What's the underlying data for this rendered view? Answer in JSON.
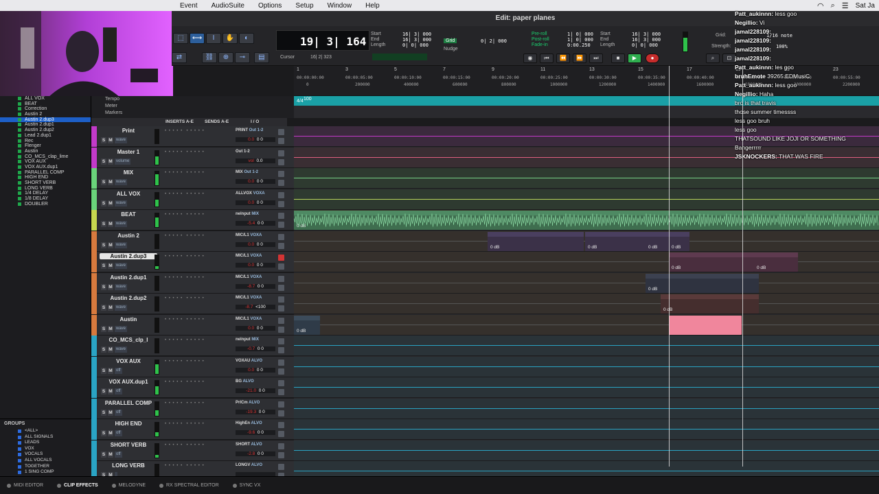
{
  "menubar": {
    "items": [
      "Event",
      "AudioSuite",
      "Options",
      "Setup",
      "Window",
      "Help"
    ],
    "clock": "Sat Ja"
  },
  "window": {
    "title": "Edit: paper planes"
  },
  "transport": {
    "main_counter": "19| 3| 164",
    "cursor_label": "Cursor",
    "cursor_value": "16| 2| 323",
    "start_label": "Start",
    "end_label": "End",
    "length_label": "Length",
    "start_value": "16| 3| 000",
    "end_value": "16| 3| 000",
    "length_value": "0| 0| 000",
    "grid_label": "Grid",
    "grid_value": "0| 2| 000",
    "nudge_label": "Nudge",
    "preroll_label": "Pre-roll",
    "postroll_label": "Post-roll",
    "fadein_label": "Fade-in",
    "preroll_value": "1| 0| 000",
    "postroll_value": "1| 0| 000",
    "fadein_value": "0:00.250",
    "start2_value": "16| 3| 000",
    "end2_value": "16| 3| 000",
    "length2_value": "0| 0| 000",
    "grid_right_label": "Grid:",
    "strength_label": "Strength:",
    "note_value": "1/16 note",
    "strength_value": "100%"
  },
  "ruler": {
    "bars": [
      "1",
      "3",
      "5",
      "7",
      "9",
      "11",
      "13",
      "15",
      "17",
      "19",
      "21",
      "23"
    ],
    "timecodes": [
      "00:00:00:00",
      "00:00:05:00",
      "00:00:10:00",
      "00:00:15:00",
      "00:00:20:00",
      "00:00:25:00",
      "00:00:30:00",
      "00:00:35:00",
      "00:00:40:00",
      "00:00:45:00",
      "00:00:50:00",
      "00:00:55:00"
    ],
    "samples": [
      "0",
      "200000",
      "400000",
      "600000",
      "800000",
      "1000000",
      "1200000",
      "1400000",
      "1600000",
      "1800000",
      "2000000",
      "2200000"
    ],
    "tempo_label": "Tempo",
    "meter_label": "Meter",
    "markers_label": "Markers",
    "tempo_value": "100",
    "meter_value": "4/4"
  },
  "clip_list": [
    "ALL VOX",
    "BEAT",
    "Correction",
    "Austin 2",
    "Austin 2.dup3",
    "Austin 2.dup1",
    "Austin 2.dup2",
    "Lead 2.dup1",
    "Rec",
    "Flenger",
    "Austin",
    "CO_MCS_clap_lime",
    "VOX AUX",
    "VOX AUX.dup1",
    "PARALLEL COMP",
    "HIGH END",
    "SHORT VERB",
    "LONG VERB",
    "1/4 DELAY",
    "1/8 DELAY",
    "DOUBLER"
  ],
  "clip_selected": "Austin 2.dup3",
  "groups": {
    "header": "GROUPS",
    "items": [
      "<ALL>",
      "ALL SIGNALS",
      "LEADS",
      "VOX",
      "VOCALS",
      "ALL VOCALS",
      "TOGETHER",
      "1 SING COMP"
    ]
  },
  "track_columns": {
    "inserts": "INSERTS A-E",
    "sends": "SENDS A-E",
    "io": "I / O"
  },
  "tracks": [
    {
      "name": "Print",
      "io1": "PRINT",
      "io2": "Out 1-2",
      "vol": "0.0",
      "pan": "0 0",
      "mode": "wave",
      "color": "#c23ac9"
    },
    {
      "name": "Master 1",
      "io1": "Out 1-2",
      "io2": "",
      "vol": "vol",
      "pan": "0.0",
      "mode": "volume",
      "color": "#c23ac9"
    },
    {
      "name": "MIX",
      "io1": "MIX",
      "io2": "Out 1-2",
      "vol": "0.0",
      "pan": "0 0",
      "mode": "wave",
      "color": "#6ad47a"
    },
    {
      "name": "ALL VOX",
      "io1": "ALLVOX",
      "io2": "VOXA",
      "vol": "0.0",
      "pan": "0 0",
      "mode": "wave",
      "color": "#6ad47a"
    },
    {
      "name": "BEAT",
      "io1": "nelnput",
      "io2": "MIX",
      "vol": "-5.4",
      "pan": "0 0",
      "mode": "wave",
      "color": "#c7d84f"
    },
    {
      "name": "Austin 2",
      "io1": "MIC/L1",
      "io2": "VOXA",
      "vol": "0.0",
      "pan": "0 0",
      "mode": "wave",
      "color": "#d77a3e"
    },
    {
      "name": "Austin 2.dup3",
      "io1": "MIC/L1",
      "io2": "VOXA",
      "vol": "0.0",
      "pan": "0 0",
      "mode": "wave",
      "color": "#d77a3e"
    },
    {
      "name": "Austin 2.dup1",
      "io1": "MIC/L1",
      "io2": "VOXA",
      "vol": "-8.7",
      "pan": "0 0",
      "mode": "wave",
      "color": "#d77a3e"
    },
    {
      "name": "Austin 2.dup2",
      "io1": "MIC/L1",
      "io2": "VOXA",
      "vol": "-8.7",
      "pan": "<100",
      "mode": "wave",
      "color": "#d77a3e"
    },
    {
      "name": "Austin",
      "io1": "MIC/L1",
      "io2": "VOXA",
      "vol": "0.0",
      "pan": "0 0",
      "mode": "wave",
      "color": "#d77a3e"
    },
    {
      "name": "CO_MCS_clp_l",
      "io1": "nelnput",
      "io2": "MIX",
      "vol": "-0.7",
      "pan": "0 0",
      "mode": "wave",
      "color": "#2aa4c4"
    },
    {
      "name": "VOX AUX",
      "io1": "VOXAU",
      "io2": "ALVO",
      "vol": "0.0",
      "pan": "0 0",
      "mode": "off",
      "color": "#2aa4c4"
    },
    {
      "name": "VOX AUX.dup1",
      "io1": "BG",
      "io2": "ALVO",
      "vol": "-21.0",
      "pan": "0 0",
      "mode": "off",
      "color": "#2aa4c4"
    },
    {
      "name": "PARALLEL COMP",
      "io1": "PrlCm",
      "io2": "ALVO",
      "vol": "-19.3",
      "pan": "0 0",
      "mode": "off",
      "color": "#2aa4c4"
    },
    {
      "name": "HIGH END",
      "io1": "HighEn",
      "io2": "ALVO",
      "vol": "-9.6",
      "pan": "0 0",
      "mode": "off",
      "color": "#2aa4c4"
    },
    {
      "name": "SHORT VERB",
      "io1": "SHORT",
      "io2": "ALVO",
      "vol": "-2.8",
      "pan": "0 0",
      "mode": "off",
      "color": "#2aa4c4"
    },
    {
      "name": "LONG VERB",
      "io1": "LONGV",
      "io2": "ALVO",
      "vol": "",
      "pan": "",
      "mode": "",
      "color": "#2aa4c4"
    }
  ],
  "clips": {
    "beat_label": "0 dB",
    "austin2_a": "0 dB",
    "austin2_b": "0 dB",
    "austin2_c": "0 dB",
    "austin2_d": "0 dB",
    "dup3_a": "0 dB",
    "dup3_b": "0 dB",
    "dup1_a": "0 dB",
    "dup2_a": "0 dB",
    "austin_a": "0 dB"
  },
  "chat": [
    {
      "user": "Patt_aukinnn:",
      "text": "less goo"
    },
    {
      "user": "Negillio:",
      "text": "Vi"
    },
    {
      "user": "jamal228109:",
      "text": ""
    },
    {
      "user": "jamal228109:",
      "text": ""
    },
    {
      "user": "jamal228109:",
      "text": ""
    },
    {
      "user": "jamal228109:",
      "text": ""
    },
    {
      "user": "Patt_aukinnn:",
      "text": "les goo"
    },
    {
      "user": "bruhEmote",
      "text": "39265:EDMusiC"
    },
    {
      "user": "Patt_aukinnn:",
      "text": "less goo"
    },
    {
      "user": "Negillio:",
      "text": "Haha"
    },
    {
      "user": "",
      "text": "bro is that travis"
    },
    {
      "user": "",
      "text": "those summer timessss"
    },
    {
      "user": "",
      "text": "less goo bruh"
    },
    {
      "user": "",
      "text": "less goo"
    },
    {
      "user": "",
      "text": "THATSOUND LIKE JOJI OR SOMETHING"
    },
    {
      "user": "",
      "text": "Bangerrrrr"
    },
    {
      "user": "JSKNOCKERS:",
      "text": "THAT WAS FIRE"
    }
  ],
  "bottom_tabs": [
    "MIDI EDITOR",
    "CLIP EFFECTS",
    "MELODYNE",
    "RX SPECTRAL EDITOR",
    "SYNC VX"
  ],
  "bottom_active": "CLIP EFFECTS"
}
